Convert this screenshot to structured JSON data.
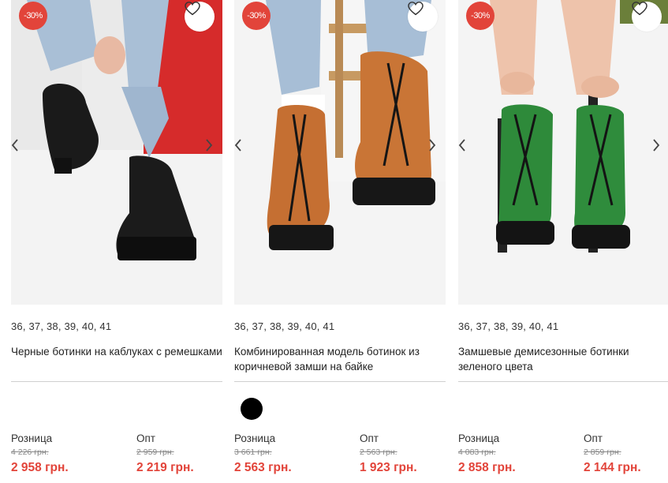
{
  "colors": {
    "discount_badge": "#e2443a",
    "price_new": "#e2443a",
    "swatch_black": "#000000"
  },
  "icons": {
    "favorite": "heart-outline-icon",
    "prev": "chevron-left-icon",
    "next": "chevron-right-icon"
  },
  "products": [
    {
      "discount": "-30%",
      "sizes": "36, 37, 38, 39, 40, 41",
      "name": "Черные ботинки на каблуках с ремешками",
      "retail_label": "Розница",
      "retail_old": "4 226 грн.",
      "retail_new": "2 958 грн.",
      "wholesale_label": "Опт",
      "wholesale_old": "2 959 грн.",
      "wholesale_new": "2 219 грн."
    },
    {
      "discount": "-30%",
      "sizes": "36, 37, 38, 39, 40, 41",
      "name": "Комбинированная модель ботинок из коричневой замши на байке",
      "retail_label": "Розница",
      "retail_old": "3 661 грн.",
      "retail_new": "2 563 грн.",
      "wholesale_label": "Опт",
      "wholesale_old": "2 563 грн.",
      "wholesale_new": "1 923 грн."
    },
    {
      "discount": "-30%",
      "sizes": "36, 37, 38, 39, 40, 41",
      "name": "Замшевые демисезонные ботинки зеленого цвета",
      "retail_label": "Розница",
      "retail_old": "4 083 грн.",
      "retail_new": "2 858 грн.",
      "wholesale_label": "Опт",
      "wholesale_old": "2 859 грн.",
      "wholesale_new": "2 144 грн."
    }
  ]
}
